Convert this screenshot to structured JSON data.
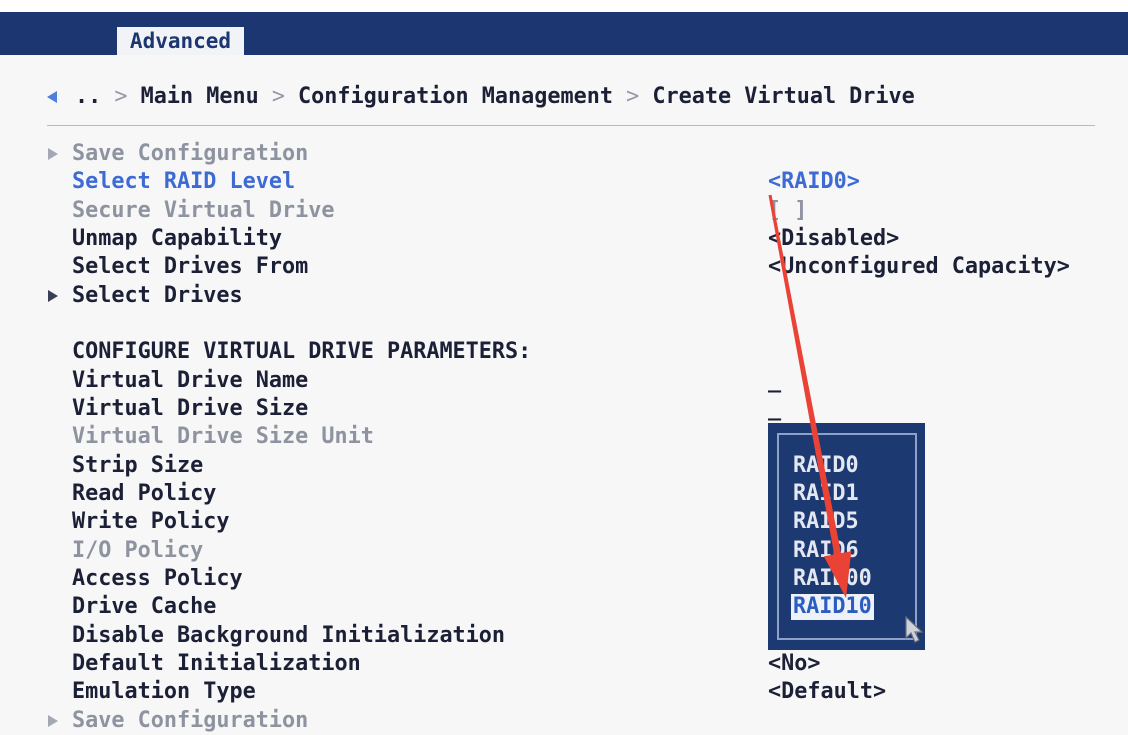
{
  "header": {
    "tabs": [
      "Advanced"
    ],
    "active_tab": "Advanced"
  },
  "breadcrumb": {
    "back_icon": "back-arrow-icon",
    "items": [
      "..",
      "Main Menu",
      "Configuration Management",
      "Create Virtual Drive"
    ],
    "separator": ">"
  },
  "menu": {
    "submenu_icon": "submenu-arrow-icon",
    "items": [
      {
        "label": "Save Configuration",
        "submenu": true,
        "enabled": false
      },
      {
        "label": "Select RAID Level",
        "value": "<RAID0>",
        "enabled": true,
        "focused": true
      },
      {
        "label": "Secure Virtual Drive",
        "value": "[ ]",
        "enabled": false
      },
      {
        "label": "Unmap Capability",
        "value": "<Disabled>",
        "enabled": true
      },
      {
        "label": "Select Drives From",
        "value": "<Unconfigured Capacity>",
        "enabled": true
      },
      {
        "label": "Select Drives",
        "submenu": true,
        "enabled": true
      },
      {
        "label": "CONFIGURE VIRTUAL DRIVE PARAMETERS:",
        "heading": true
      },
      {
        "label": "Virtual Drive Name",
        "value": "_",
        "enabled": true
      },
      {
        "label": "Virtual Drive Size",
        "value": "_",
        "enabled": true
      },
      {
        "label": "Virtual Drive Size Unit",
        "enabled": false
      },
      {
        "label": "Strip Size",
        "enabled": true
      },
      {
        "label": "Read Policy",
        "enabled": true
      },
      {
        "label": "Write Policy",
        "enabled": true
      },
      {
        "label": "I/O Policy",
        "enabled": false
      },
      {
        "label": "Access Policy",
        "enabled": true
      },
      {
        "label": "Drive Cache",
        "enabled": true
      },
      {
        "label": "Disable Background Initialization",
        "enabled": true
      },
      {
        "label": "Default Initialization",
        "value": "<No>",
        "enabled": true
      },
      {
        "label": "Emulation Type",
        "value": "<Default>",
        "enabled": true
      },
      {
        "label": "Save Configuration",
        "submenu": true,
        "enabled": false
      }
    ]
  },
  "raid_level_popup": {
    "options": [
      "RAID0",
      "RAID1",
      "RAID5",
      "RAID6",
      "RAID00",
      "RAID10"
    ],
    "highlighted": "RAID10"
  },
  "cursor_icon": "mouse-pointer-icon",
  "colors": {
    "header_bg": "#1b3670",
    "focused_text": "#3d6bd3",
    "disabled_text": "#8e93a0",
    "popup_bg": "#1d3972",
    "popup_highlight_text": "#2b5cc0",
    "annotation_arrow": "#ea4335"
  }
}
